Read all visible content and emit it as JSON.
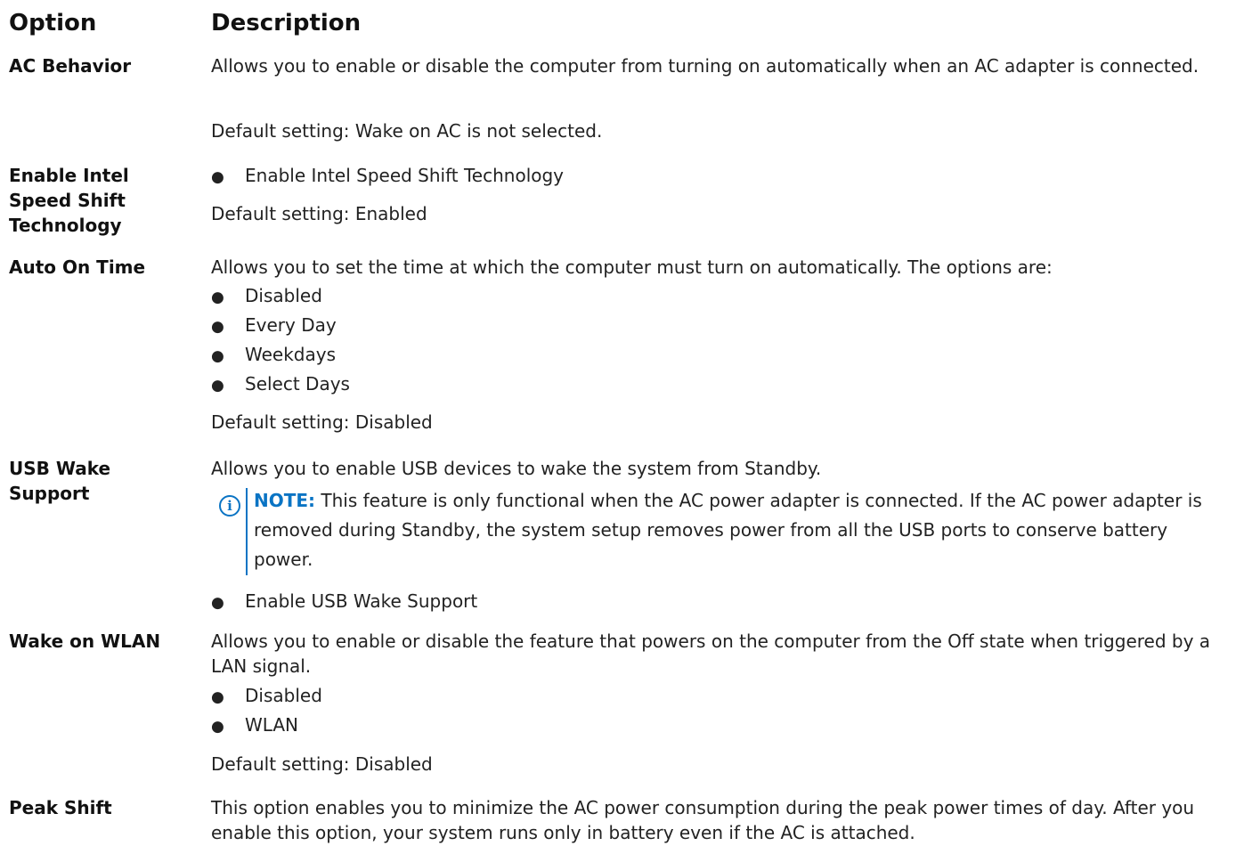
{
  "headers": {
    "option": "Option",
    "description": "Description"
  },
  "rows": {
    "ac_behavior": {
      "option": "AC Behavior",
      "description": "Allows you to enable or disable the computer from turning on automatically when an AC adapter is connected.",
      "default": "Default setting: Wake on AC is not selected."
    },
    "speed_shift": {
      "option_line1": "Enable Intel",
      "option_line2": "Speed Shift",
      "option_line3": "Technology",
      "bullet": "Enable Intel Speed Shift Technology",
      "default": "Default setting: Enabled"
    },
    "auto_on_time": {
      "option": "Auto On Time",
      "description": "Allows you to set the time at which the computer must turn on automatically. The options are:",
      "items": [
        "Disabled",
        "Every Day",
        "Weekdays",
        "Select Days"
      ],
      "default": "Default setting: Disabled"
    },
    "usb_wake": {
      "option_line1": "USB Wake",
      "option_line2": "Support",
      "description": "Allows you to enable USB devices to wake the system from Standby.",
      "note_label": "NOTE:",
      "note_text": " This feature is only functional when the AC power adapter is connected. If the AC power adapter is removed during Standby, the system setup removes power from all the USB ports to conserve battery power.",
      "note_icon": "info-icon",
      "bullet": "Enable USB Wake Support"
    },
    "wake_on_wlan": {
      "option": "Wake on WLAN",
      "description": "Allows you to enable or disable the feature that powers on the computer from the Off state when triggered by a LAN signal.",
      "items": [
        "Disabled",
        "WLAN"
      ],
      "default": "Default setting: Disabled"
    },
    "peak_shift": {
      "option": "Peak Shift",
      "description": "This option enables you to minimize the AC power consumption during the peak power times of day. After you enable this option, your system runs only in battery even if the AC is attached."
    }
  },
  "colors": {
    "note_accent": "#0a74c4",
    "text": "#222222"
  }
}
